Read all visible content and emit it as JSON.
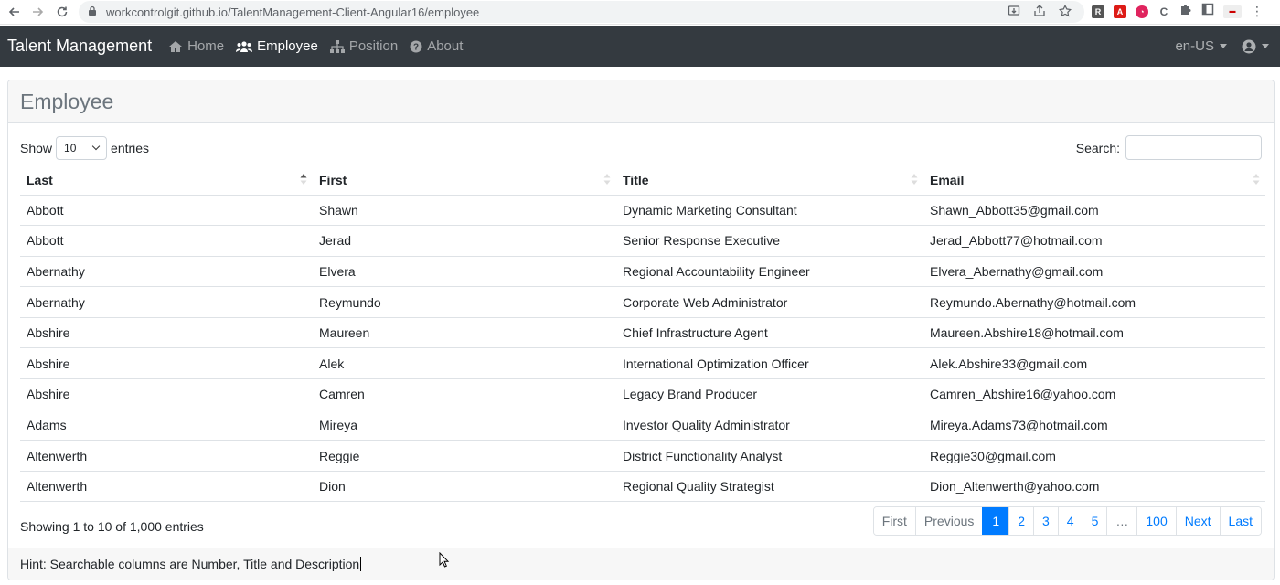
{
  "browser": {
    "url": "workcontrolgit.github.io/TalentManagement-Client-Angular16/employee"
  },
  "navbar": {
    "brand": "Talent Management",
    "links": [
      {
        "label": "Home",
        "icon": "home-icon"
      },
      {
        "label": "Employee",
        "icon": "users-icon"
      },
      {
        "label": "Position",
        "icon": "sitemap-icon"
      },
      {
        "label": "About",
        "icon": "question-circle-icon"
      }
    ],
    "language": "en-US",
    "user_icon": "user-circle-icon"
  },
  "card": {
    "title": "Employee"
  },
  "controls": {
    "show_label": "Show",
    "page_size": "10",
    "entries_label": "entries",
    "search_label": "Search:",
    "search_value": ""
  },
  "table": {
    "headers": [
      "Last",
      "First",
      "Title",
      "Email"
    ],
    "rows": [
      [
        "Abbott",
        "Shawn",
        "Dynamic Marketing Consultant",
        "Shawn_Abbott35@gmail.com"
      ],
      [
        "Abbott",
        "Jerad",
        "Senior Response Executive",
        "Jerad_Abbott77@hotmail.com"
      ],
      [
        "Abernathy",
        "Elvera",
        "Regional Accountability Engineer",
        "Elvera_Abernathy@gmail.com"
      ],
      [
        "Abernathy",
        "Reymundo",
        "Corporate Web Administrator",
        "Reymundo.Abernathy@hotmail.com"
      ],
      [
        "Abshire",
        "Maureen",
        "Chief Infrastructure Agent",
        "Maureen.Abshire18@hotmail.com"
      ],
      [
        "Abshire",
        "Alek",
        "International Optimization Officer",
        "Alek.Abshire33@gmail.com"
      ],
      [
        "Abshire",
        "Camren",
        "Legacy Brand Producer",
        "Camren_Abshire16@yahoo.com"
      ],
      [
        "Adams",
        "Mireya",
        "Investor Quality Administrator",
        "Mireya.Adams73@hotmail.com"
      ],
      [
        "Altenwerth",
        "Reggie",
        "District Functionality Analyst",
        "Reggie30@gmail.com"
      ],
      [
        "Altenwerth",
        "Dion",
        "Regional Quality Strategist",
        "Dion_Altenwerth@yahoo.com"
      ]
    ]
  },
  "footer_info": "Showing 1 to 10 of 1,000 entries",
  "pagination": {
    "first": "First",
    "previous": "Previous",
    "pages": [
      "1",
      "2",
      "3",
      "4",
      "5",
      "…",
      "100"
    ],
    "current": "1",
    "next": "Next",
    "last": "Last"
  },
  "hint": "Hint: Searchable columns are Number, Title and Description",
  "colors": {
    "navbar_bg": "#343a40",
    "primary": "#007bff"
  }
}
